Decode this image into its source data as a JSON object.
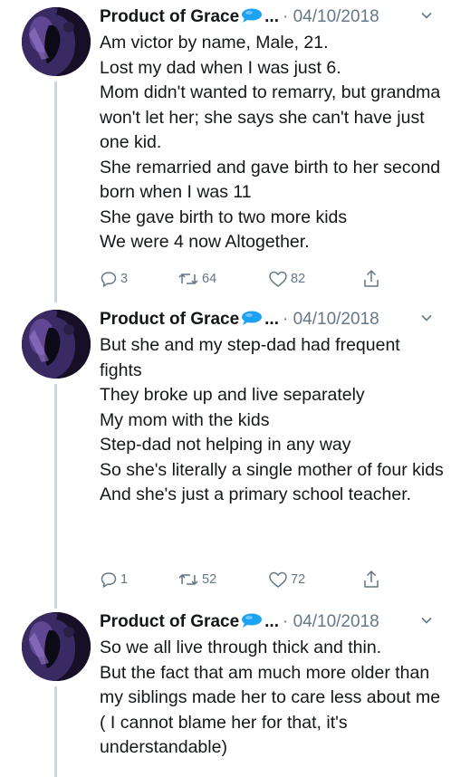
{
  "tweets": [
    {
      "author": "Product of Grace",
      "ellipsis": "...",
      "date": "· 04/10/2018",
      "text": "Am victor by name, Male, 21.\nLost my dad when I was just 6.\nMom didn't wanted to remarry, but grandma won't let her; she says she can't have just one kid.\nShe remarried and gave birth to her second born when I was 11\nShe gave birth to two more kids\nWe were 4 now Altogether.",
      "replies": "3",
      "retweets": "64",
      "likes": "82"
    },
    {
      "author": "Product of Grace",
      "ellipsis": "...",
      "date": "· 04/10/2018",
      "text": "But she and my step-dad had frequent fights\nThey broke up and live separately\nMy mom with the kids\nStep-dad not helping in any way\nSo she's literally a single mother of four kids\nAnd she's just a primary school teacher.",
      "replies": "1",
      "retweets": "52",
      "likes": "72"
    },
    {
      "author": "Product of Grace",
      "ellipsis": "...",
      "date": "· 04/10/2018",
      "text": "So we all live through thick and thin.\nBut the fact that am much more older than my siblings made her to care less about me ( I cannot blame her for that, it's understandable)"
    }
  ],
  "colors": {
    "text": "#14171a",
    "muted": "#657786",
    "thread": "#ccd6dd",
    "bubble": "#1da1f2"
  },
  "icons": [
    "reply-icon",
    "retweet-icon",
    "like-icon",
    "share-icon",
    "chevron-down-icon",
    "speech-bubble-emoji"
  ]
}
